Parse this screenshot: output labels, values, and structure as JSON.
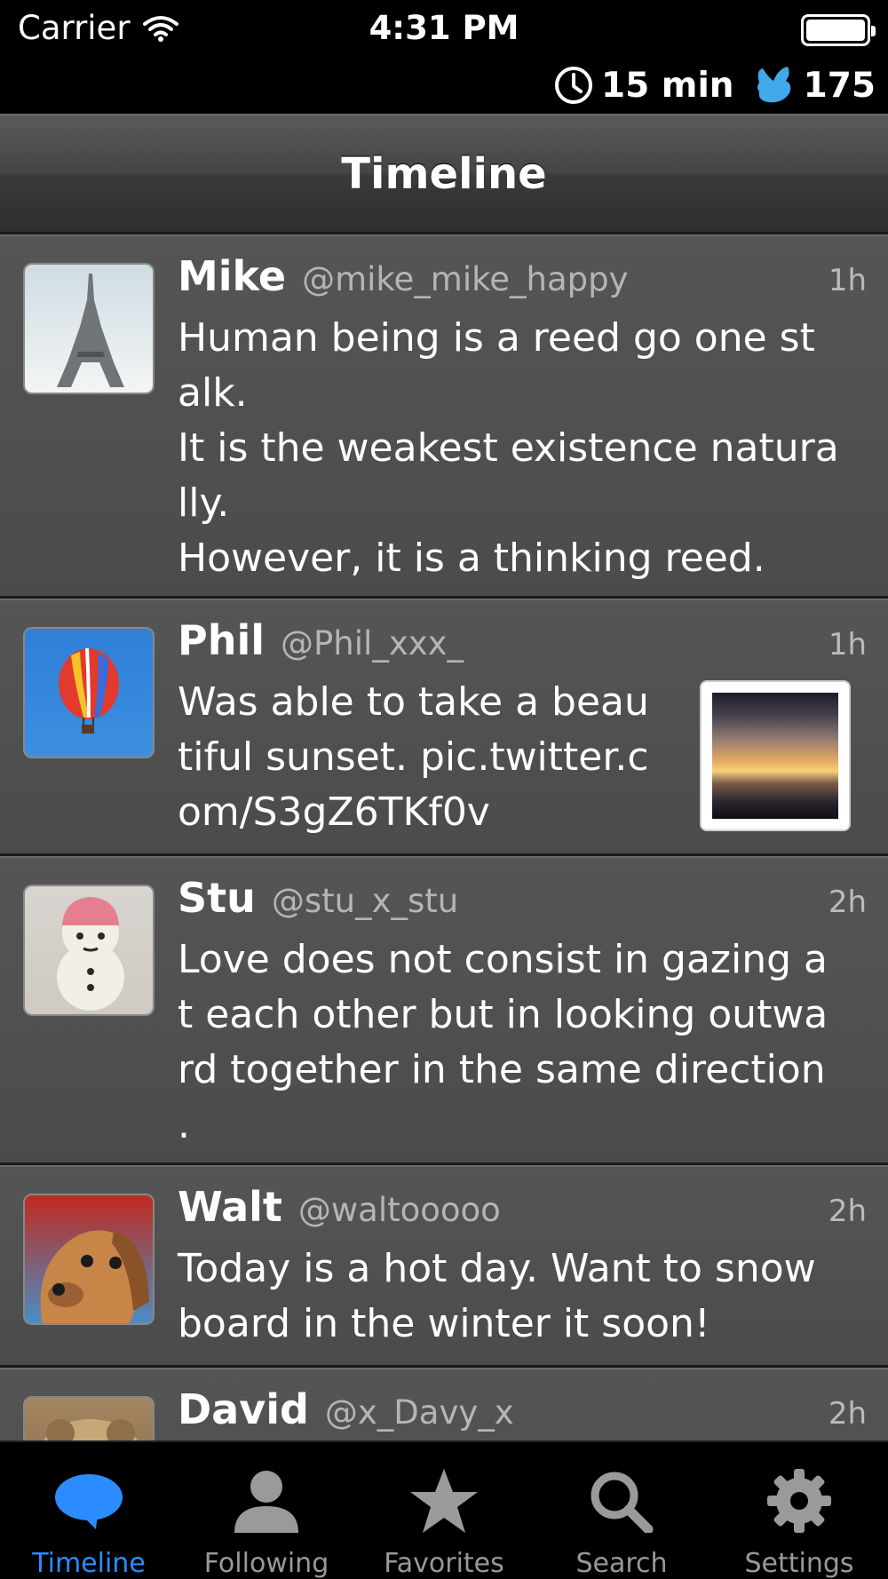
{
  "status_bar": {
    "carrier": "Carrier",
    "time": "4:31 PM",
    "timer": "15 min",
    "count": "175",
    "accent": "#41a9e9"
  },
  "nav": {
    "title": "Timeline"
  },
  "tweets": [
    {
      "name": "Mike",
      "handle": "@mike_mike_happy",
      "time": "1h",
      "text": "Human being is a reed go one st\nalk.\nIt is the weakest existence natura\nlly.\nHowever, it is a thinking reed."
    },
    {
      "name": "Phil",
      "handle": "@Phil_xxx_",
      "time": "1h",
      "text": "Was able to take a beau\ntiful sunset. pic.twitter.c\nom/S3gZ6TKf0v"
    },
    {
      "name": "Stu",
      "handle": "@stu_x_stu",
      "time": "2h",
      "text": "Love does not consist in gazing a\nt each other but in looking outwa\nrd together in the same direction\n."
    },
    {
      "name": "Walt",
      "handle": "@waltooooo",
      "time": "2h",
      "text": "Today is a hot day. Want to snow\nboard in the winter it soon!"
    },
    {
      "name": "David",
      "handle": "@x_Davy_x",
      "time": "2h",
      "text": ""
    }
  ],
  "tab_bar": {
    "active_color": "#2a8cff",
    "items": [
      {
        "label": "Timeline",
        "icon": "speech-bubble-icon"
      },
      {
        "label": "Following",
        "icon": "person-icon"
      },
      {
        "label": "Favorites",
        "icon": "star-icon"
      },
      {
        "label": "Search",
        "icon": "magnifier-icon"
      },
      {
        "label": "Settings",
        "icon": "gear-icon"
      }
    ]
  }
}
